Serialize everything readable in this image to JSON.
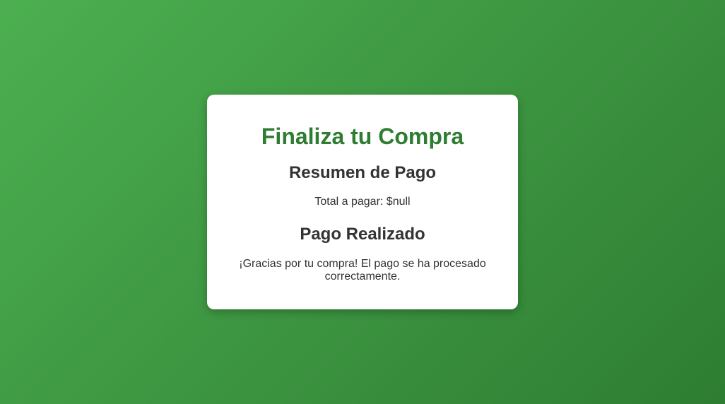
{
  "checkout": {
    "title": "Finaliza tu Compra",
    "summary_heading": "Resumen de Pago",
    "total_label": "Total a pagar: ",
    "total_value": "$null",
    "confirmation_heading": "Pago Realizado",
    "confirmation_message": "¡Gracias por tu compra! El pago se ha procesado correctamente."
  },
  "colors": {
    "background_start": "#4caf50",
    "background_end": "#2e7d32",
    "title": "#2e7d32",
    "text": "#333333",
    "card": "#ffffff"
  }
}
